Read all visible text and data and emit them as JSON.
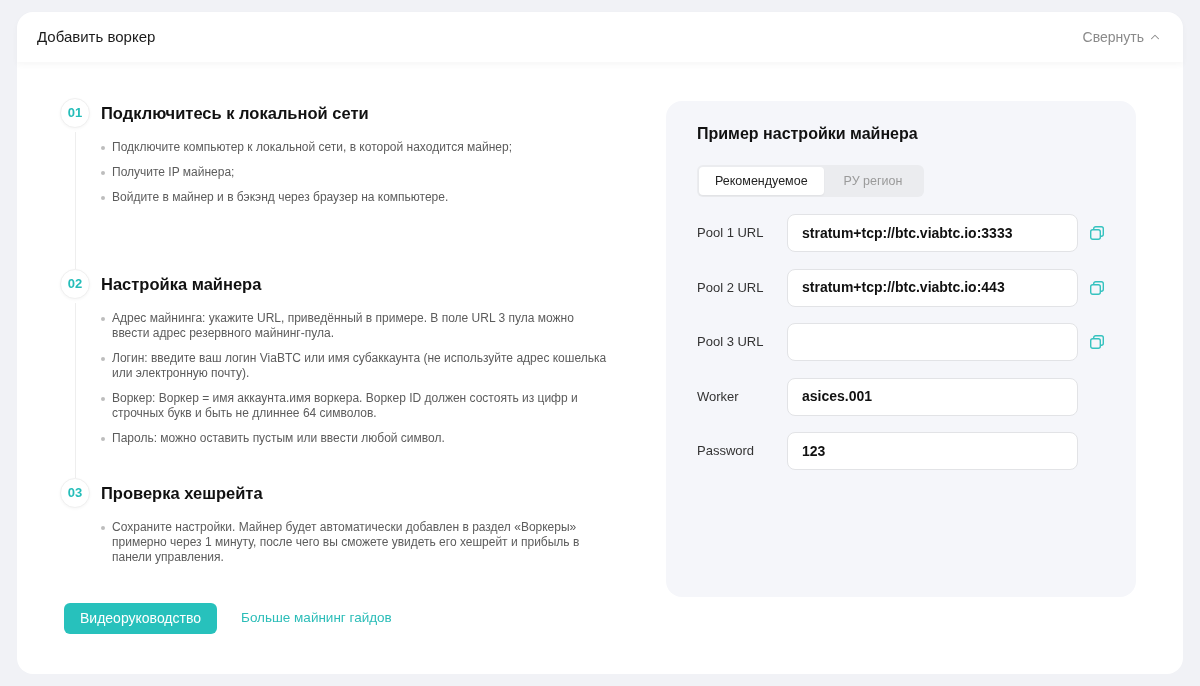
{
  "panel": {
    "title": "Добавить воркер",
    "collapse": {
      "label": "Свернуть",
      "expanded": true
    }
  },
  "steps": [
    {
      "number": "01",
      "title": "Подключитесь к локальной сети",
      "items": [
        "Подключите компьютер к локальной сети, в которой находится майнер;",
        "Получите IP майнера;",
        "Войдите в майнер и в бэкэнд через браузер на компьютере."
      ]
    },
    {
      "number": "02",
      "title": "Настройка майнера",
      "items": [
        "Адрес майнинга: укажите URL, приведённый в примере. В поле URL 3 пула можно ввести адрес резервного майнинг-пула.",
        "Логин: введите ваш логин ViaBTC или имя субаккаунта (не используйте адрес кошелька или электронную почту).",
        "Воркер: Воркер = имя аккаунта.имя воркера. Воркер ID должен состоять из цифр и строчных букв и быть не длиннее 64 символов.",
        "Пароль: можно оставить пустым или ввести любой символ."
      ]
    },
    {
      "number": "03",
      "title": "Проверка хешрейта",
      "items": [
        "Сохраните настройки. Майнер будет автоматически добавлен в раздел «Воркеры» примерно через 1 минуту, после чего вы сможете увидеть его хешрейт и прибыль в панели управления."
      ]
    }
  ],
  "actions": {
    "video_button": "Видеоруководство",
    "guides_link": "Больше майнинг гайдов"
  },
  "example": {
    "title": "Пример настройки майнера",
    "tabs": [
      {
        "label": "Рекомендуемое",
        "selected": true
      },
      {
        "label": "РУ регион",
        "selected": false
      }
    ],
    "fields": [
      {
        "label": "Pool 1 URL",
        "value": "stratum+tcp://btc.viabtc.io:3333",
        "copyable": true
      },
      {
        "label": "Pool 2 URL",
        "value": "stratum+tcp://btc.viabtc.io:443",
        "copyable": true
      },
      {
        "label": "Pool 3 URL",
        "copyable": true
      },
      {
        "label": "Worker",
        "value": "asices.001",
        "copyable": false
      },
      {
        "label": "Password",
        "value": "123",
        "copyable": false
      }
    ]
  }
}
